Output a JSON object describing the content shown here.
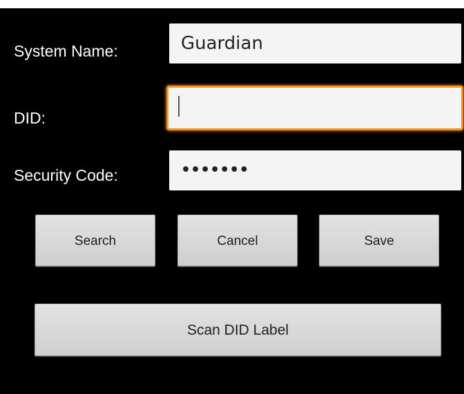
{
  "form": {
    "system_name": {
      "label": "System Name:",
      "value": "Guardian"
    },
    "did": {
      "label": "DID:",
      "value": ""
    },
    "security_code": {
      "label": "Security Code:",
      "value_masked": "•••••••"
    }
  },
  "buttons": {
    "search": "Search",
    "cancel": "Cancel",
    "save": "Save",
    "scan": "Scan DID Label"
  },
  "colors": {
    "background": "#000000",
    "field_background": "#f4f4f4",
    "focus_border": "#f0931f",
    "button_background": "#d9d9d9"
  }
}
